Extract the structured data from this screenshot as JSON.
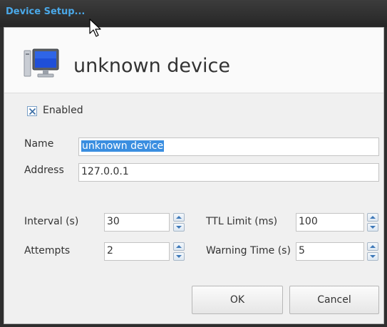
{
  "window": {
    "title": "Device Setup...",
    "accent_color": "#4aa8e8"
  },
  "header": {
    "device_icon": "monitor-icon",
    "device_name": "unknown device"
  },
  "form": {
    "enabled": {
      "label": "Enabled",
      "checked": true
    },
    "name": {
      "label": "Name",
      "value": "unknown device",
      "selected": true
    },
    "address": {
      "label": "Address",
      "value": "127.0.0.1"
    },
    "interval": {
      "label": "Interval (s)",
      "value": "30"
    },
    "attempts": {
      "label": "Attempts",
      "value": "2"
    },
    "ttl_limit": {
      "label": "TTL Limit (ms)",
      "value": "100"
    },
    "warning_time": {
      "label": "Warning Time (s)",
      "value": "5"
    }
  },
  "buttons": {
    "ok": "OK",
    "cancel": "Cancel"
  },
  "selection_color": "#3a8ee0"
}
